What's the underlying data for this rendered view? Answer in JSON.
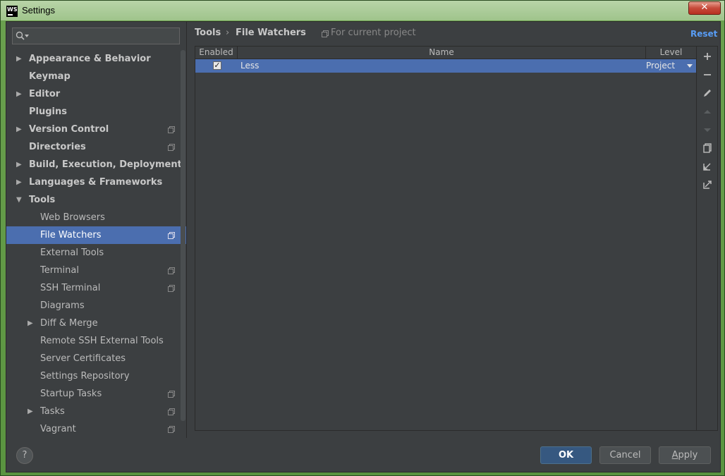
{
  "window": {
    "title": "Settings",
    "app_icon_text": "WS"
  },
  "search": {
    "placeholder": ""
  },
  "sidebar": {
    "items": [
      {
        "label": "Appearance & Behavior",
        "bold": true,
        "arrow": "right",
        "level": 0,
        "project": false
      },
      {
        "label": "Keymap",
        "bold": true,
        "arrow": "",
        "level": 0,
        "project": false
      },
      {
        "label": "Editor",
        "bold": true,
        "arrow": "right",
        "level": 0,
        "project": false
      },
      {
        "label": "Plugins",
        "bold": true,
        "arrow": "",
        "level": 0,
        "project": false
      },
      {
        "label": "Version Control",
        "bold": true,
        "arrow": "right",
        "level": 0,
        "project": true
      },
      {
        "label": "Directories",
        "bold": true,
        "arrow": "",
        "level": 0,
        "project": true
      },
      {
        "label": "Build, Execution, Deployment",
        "bold": true,
        "arrow": "right",
        "level": 0,
        "project": false
      },
      {
        "label": "Languages & Frameworks",
        "bold": true,
        "arrow": "right",
        "level": 0,
        "project": false
      },
      {
        "label": "Tools",
        "bold": true,
        "arrow": "down",
        "level": 0,
        "project": false
      },
      {
        "label": "Web Browsers",
        "bold": false,
        "arrow": "",
        "level": 1,
        "project": false
      },
      {
        "label": "File Watchers",
        "bold": false,
        "arrow": "",
        "level": 1,
        "project": true,
        "selected": true
      },
      {
        "label": "External Tools",
        "bold": false,
        "arrow": "",
        "level": 1,
        "project": false
      },
      {
        "label": "Terminal",
        "bold": false,
        "arrow": "",
        "level": 1,
        "project": true
      },
      {
        "label": "SSH Terminal",
        "bold": false,
        "arrow": "",
        "level": 1,
        "project": true
      },
      {
        "label": "Diagrams",
        "bold": false,
        "arrow": "",
        "level": 1,
        "project": false
      },
      {
        "label": "Diff & Merge",
        "bold": false,
        "arrow": "right",
        "level": 1,
        "project": false
      },
      {
        "label": "Remote SSH External Tools",
        "bold": false,
        "arrow": "",
        "level": 1,
        "project": false
      },
      {
        "label": "Server Certificates",
        "bold": false,
        "arrow": "",
        "level": 1,
        "project": false
      },
      {
        "label": "Settings Repository",
        "bold": false,
        "arrow": "",
        "level": 1,
        "project": false
      },
      {
        "label": "Startup Tasks",
        "bold": false,
        "arrow": "",
        "level": 1,
        "project": true
      },
      {
        "label": "Tasks",
        "bold": false,
        "arrow": "right",
        "level": 1,
        "project": true
      },
      {
        "label": "Vagrant",
        "bold": false,
        "arrow": "",
        "level": 1,
        "project": true
      }
    ]
  },
  "breadcrumb": {
    "parent": "Tools",
    "separator": "›",
    "current": "File Watchers",
    "scope": "For current project"
  },
  "reset_label": "Reset",
  "table": {
    "headers": {
      "enabled": "Enabled",
      "name": "Name",
      "level": "Level"
    },
    "rows": [
      {
        "enabled": true,
        "name": "Less",
        "level": "Project"
      }
    ]
  },
  "toolbar_icons": [
    "add-icon",
    "remove-icon",
    "edit-icon",
    "move-up-icon",
    "move-down-icon",
    "copy-icon",
    "import-icon",
    "export-icon"
  ],
  "buttons": {
    "help": "?",
    "ok": "OK",
    "cancel": "Cancel",
    "apply_first": "A",
    "apply_rest": "pply"
  },
  "colors": {
    "selection": "#4b6eaf",
    "link": "#589df6",
    "background": "#3c3f41"
  }
}
